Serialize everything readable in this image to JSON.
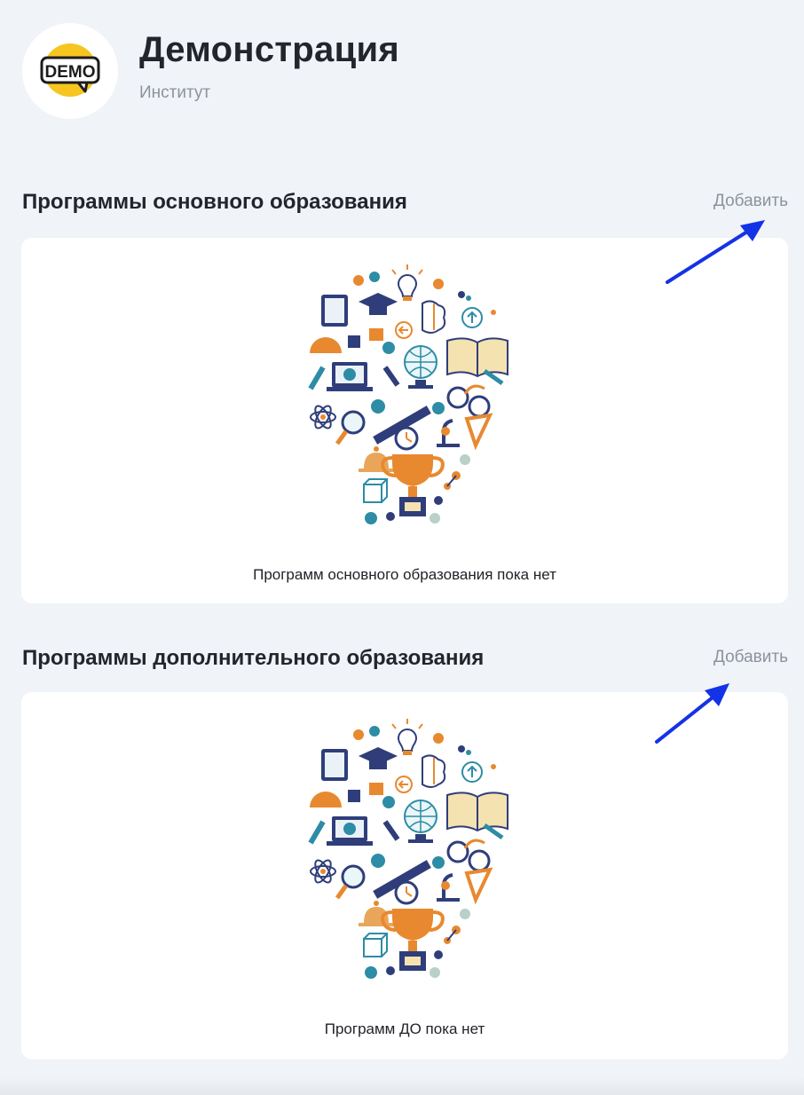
{
  "header": {
    "logo_text": "DEMO",
    "org_name": "Демонстрация",
    "org_type": "Институт"
  },
  "sections": [
    {
      "title": "Программы основного образования",
      "add_label": "Добавить",
      "empty_text": "Программ основного образования пока нет"
    },
    {
      "title": "Программы дополнительного образования",
      "add_label": "Добавить",
      "empty_text": "Программ ДО пока нет"
    }
  ],
  "colors": {
    "background": "#f0f3f7",
    "card": "#ffffff",
    "title": "#23252c",
    "muted": "#8d929c",
    "annotation_arrow": "#1432e6",
    "logo_yellow": "#f7c520",
    "illus_navy": "#2f3e7a",
    "illus_orange": "#e8892f",
    "illus_teal": "#2d8ca6"
  }
}
